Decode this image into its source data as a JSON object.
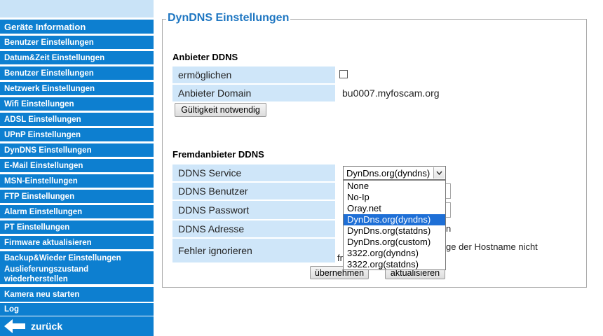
{
  "sidebar": {
    "items": [
      {
        "label": "Geräte Information"
      },
      {
        "label": "Benutzer Einstellungen"
      },
      {
        "label": "Datum&Zeit Einstellungen"
      },
      {
        "label": "Benutzer Einstellungen"
      },
      {
        "label": "Netzwerk Einstellungen"
      },
      {
        "label": "Wifi Einstellungen"
      },
      {
        "label": "ADSL Einstellungen"
      },
      {
        "label": "UPnP Einstellungen"
      },
      {
        "label": "DynDNS Einstellungen"
      },
      {
        "label": "E-Mail Einstellungen"
      },
      {
        "label": "MSN-Einstellungen"
      },
      {
        "label": "FTP Einstellungen"
      },
      {
        "label": "Alarm Einstellungen"
      },
      {
        "label": "PT Einstellungen"
      },
      {
        "label": "Firmware aktualisieren"
      },
      {
        "label": "Backup&Wieder Einstellungen"
      },
      {
        "label": "Auslieferungszustand wiederherstellen"
      },
      {
        "label": "Kamera neu starten"
      },
      {
        "label": "Log"
      }
    ],
    "back_label": "zurück"
  },
  "main": {
    "legend": "DynDNS Einstellungen",
    "provider": {
      "title": "Anbieter DDNS",
      "enable_label": "ermöglichen",
      "domain_label": "Anbieter Domain",
      "domain_value": "bu0007.myfoscam.org",
      "validity_button": "Gültigkeit notwendig"
    },
    "third_party": {
      "title": "Fremdanbieter DDNS",
      "service_label": "DDNS Service",
      "service_selected": "DynDns.org(dyndns)",
      "service_options": [
        "None",
        "No-Ip",
        "Oray.net",
        "DynDns.org(dyndns)",
        "DynDns.org(statdns)",
        "DynDns.org(custom)",
        "3322.org(dyndns)",
        "3322.org(statdns)"
      ],
      "user_label": "DDNS Benutzer",
      "password_label": "DDNS Passwort",
      "address_label": "DDNS Adresse",
      "ignore_label": "Fehler ignorieren",
      "ignore_text_line1": "ge der Hostname nicht",
      "ignore_text_line2": "fre",
      "address_partial": "n"
    },
    "submit_button": "übernehmen",
    "refresh_button": "aktualisieren"
  }
}
